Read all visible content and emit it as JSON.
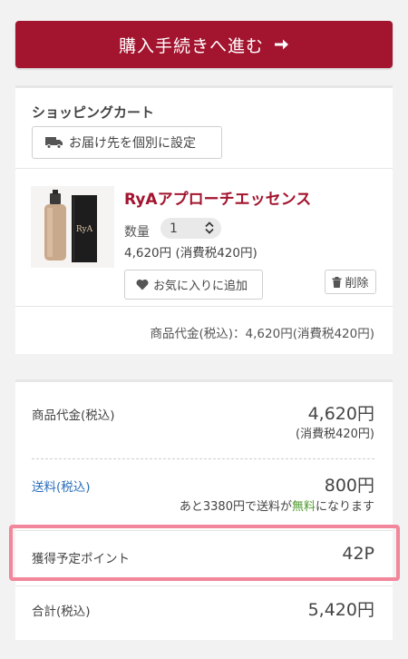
{
  "checkout": {
    "label": "購入手続きへ進む",
    "icon": "arrow-right-icon",
    "color": "#a3142e"
  },
  "cart": {
    "title": "ショッピングカート",
    "ship_button": {
      "label": "お届け先を個別に設定",
      "icon": "truck-icon"
    },
    "item": {
      "name": "RyAアプローチエッセンス",
      "qty_label": "数量",
      "qty_value": "1",
      "price": "4,620円 (消費税420円)",
      "favorite_label": "お気に入りに追加",
      "favorite_icon": "heart-icon",
      "delete_label": "削除",
      "delete_icon": "trash-icon",
      "product_logo_text": "RyA"
    },
    "subtotal": "商品代金(税込)：4,620円(消費税420円)"
  },
  "summary": {
    "goods": {
      "label": "商品代金(税込)",
      "value": "4,620円",
      "tax": "(消費税420円)"
    },
    "shipping": {
      "label": "送料(税込)",
      "value": "800円",
      "note_prefix": "あと3380円で送料が",
      "note_free": "無料",
      "note_suffix": "になります"
    },
    "points": {
      "label": "獲得予定ポイント",
      "value": "42P"
    },
    "total": {
      "label": "合計(税込)",
      "value": "5,420円"
    }
  },
  "colors": {
    "accent": "#a3142e",
    "link": "#2a6ebb",
    "free": "#4e9a2c",
    "highlight": "#f2869b"
  }
}
